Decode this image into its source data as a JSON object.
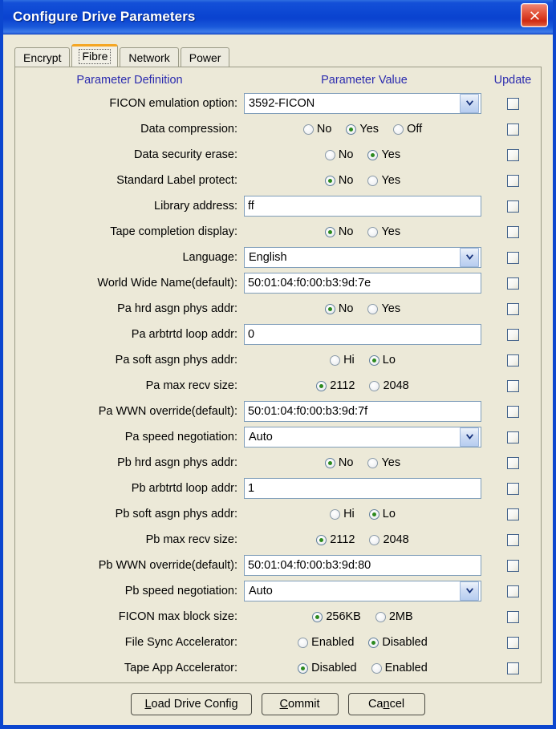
{
  "window": {
    "title": "Configure Drive Parameters",
    "close_icon": "close-icon"
  },
  "tabs": [
    {
      "label": "Encrypt",
      "selected": false
    },
    {
      "label": "Fibre",
      "selected": true
    },
    {
      "label": "Network",
      "selected": false
    },
    {
      "label": "Power",
      "selected": false
    }
  ],
  "columns": {
    "definition": "Parameter Definition",
    "value": "Parameter Value",
    "update": "Update"
  },
  "rows": [
    {
      "label": "FICON emulation option:",
      "type": "combo",
      "value": "3592-FICON",
      "update": false
    },
    {
      "label": "Data compression:",
      "type": "radio",
      "options": [
        "No",
        "Yes",
        "Off"
      ],
      "selected": "Yes",
      "update": false
    },
    {
      "label": "Data security erase:",
      "type": "radio",
      "options": [
        "No",
        "Yes"
      ],
      "selected": "Yes",
      "update": false
    },
    {
      "label": "Standard Label protect:",
      "type": "radio",
      "options": [
        "No",
        "Yes"
      ],
      "selected": "No",
      "update": false
    },
    {
      "label": "Library address:",
      "type": "text",
      "value": "ff",
      "update": false
    },
    {
      "label": "Tape completion display:",
      "type": "radio",
      "options": [
        "No",
        "Yes"
      ],
      "selected": "No",
      "update": false
    },
    {
      "label": "Language:",
      "type": "combo",
      "value": "English",
      "update": false
    },
    {
      "label": "World Wide Name(default):",
      "type": "text",
      "value": "50:01:04:f0:00:b3:9d:7e",
      "update": false
    },
    {
      "label": "Pa hrd asgn phys addr:",
      "type": "radio",
      "options": [
        "No",
        "Yes"
      ],
      "selected": "No",
      "update": false
    },
    {
      "label": "Pa arbtrtd loop addr:",
      "type": "text",
      "value": "0",
      "update": false
    },
    {
      "label": "Pa soft asgn phys addr:",
      "type": "radio",
      "options": [
        "Hi",
        "Lo"
      ],
      "selected": "Lo",
      "update": false
    },
    {
      "label": "Pa max recv size:",
      "type": "radio",
      "options": [
        "2112",
        "2048"
      ],
      "selected": "2112",
      "update": false
    },
    {
      "label": "Pa WWN override(default):",
      "type": "text",
      "value": "50:01:04:f0:00:b3:9d:7f",
      "update": false
    },
    {
      "label": "Pa speed negotiation:",
      "type": "combo",
      "value": "Auto",
      "update": false
    },
    {
      "label": "Pb hrd asgn phys addr:",
      "type": "radio",
      "options": [
        "No",
        "Yes"
      ],
      "selected": "No",
      "update": false
    },
    {
      "label": "Pb arbtrtd loop addr:",
      "type": "text",
      "value": "1",
      "update": false
    },
    {
      "label": "Pb soft asgn phys addr:",
      "type": "radio",
      "options": [
        "Hi",
        "Lo"
      ],
      "selected": "Lo",
      "update": false
    },
    {
      "label": "Pb max recv size:",
      "type": "radio",
      "options": [
        "2112",
        "2048"
      ],
      "selected": "2112",
      "update": false
    },
    {
      "label": "Pb WWN override(default):",
      "type": "text",
      "value": "50:01:04:f0:00:b3:9d:80",
      "update": false
    },
    {
      "label": "Pb speed negotiation:",
      "type": "combo",
      "value": "Auto",
      "update": false
    },
    {
      "label": "FICON max block size:",
      "type": "radio",
      "options": [
        "256KB",
        "2MB"
      ],
      "selected": "256KB",
      "update": false
    },
    {
      "label": "File Sync Accelerator:",
      "type": "radio",
      "options": [
        "Enabled",
        "Disabled"
      ],
      "selected": "Disabled",
      "update": false
    },
    {
      "label": "Tape App Accelerator:",
      "type": "radio",
      "options": [
        "Disabled",
        "Enabled"
      ],
      "selected": "Disabled",
      "update": false
    }
  ],
  "buttons": [
    {
      "label": "Load Drive Config",
      "mnemonic": "L",
      "name": "load-drive-config-button"
    },
    {
      "label": "Commit",
      "mnemonic": "C",
      "name": "commit-button"
    },
    {
      "label": "Cancel",
      "mnemonic": "n",
      "name": "cancel-button"
    }
  ],
  "colors": {
    "titlebar": "#0b46d2",
    "accent_tab": "#f5a623",
    "header_text": "#2b2bae",
    "radio_dot": "#2c8a1e",
    "face": "#ece9d8"
  }
}
